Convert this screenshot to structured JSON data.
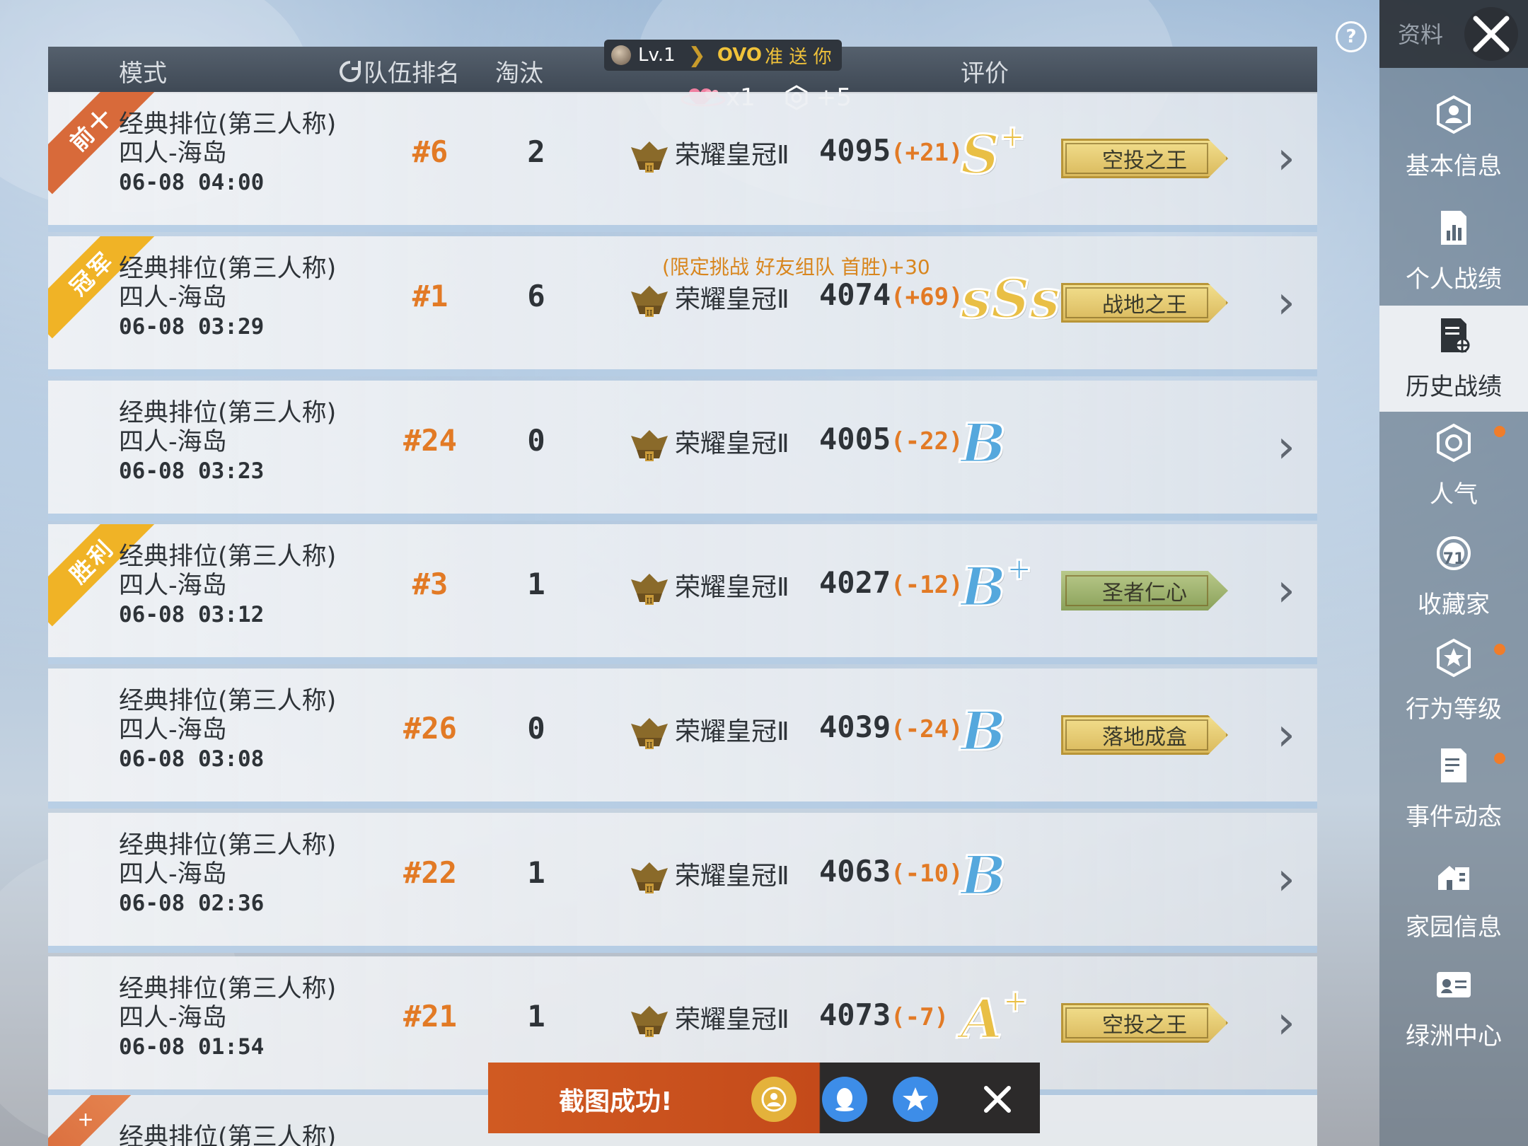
{
  "header": {
    "col_mode": "模式",
    "col_team_rank": "队伍排名",
    "col_eliminations": "淘汰",
    "col_rating": "评价",
    "level": "Lv.1",
    "player_name": "OVO",
    "player_name_suffix": "准 送 你",
    "likes_count": "x1",
    "popularity_gain": "+5"
  },
  "rows": [
    {
      "ribbon": "前十",
      "ribbon_color": "#d86a3a",
      "mode": "经典排位(第三人称)",
      "map": "四人-海岛",
      "date": "06-08 04:00",
      "rank": "#6",
      "elims": "2",
      "tier": "荣耀皇冠Ⅱ",
      "score": "4095",
      "delta": "(+21)",
      "delta_color": "#e27a25",
      "grade": "S",
      "grade_plus": "+",
      "grade_color": "gold",
      "promo": "",
      "title": "空投之王",
      "title_style": "gold"
    },
    {
      "ribbon": "冠军",
      "ribbon_color": "#f0b326",
      "mode": "经典排位(第三人称)",
      "map": "四人-海岛",
      "date": "06-08 03:29",
      "rank": "#1",
      "elims": "6",
      "tier": "荣耀皇冠Ⅱ",
      "score": "4074",
      "delta": "(+69)",
      "delta_color": "#e27a25",
      "grade": "sSs",
      "grade_plus": "",
      "grade_color": "gold",
      "promo": "(限定挑战 好友组队 首胜)+30",
      "title": "战地之王",
      "title_style": "gold"
    },
    {
      "ribbon": "",
      "ribbon_color": "",
      "mode": "经典排位(第三人称)",
      "map": "四人-海岛",
      "date": "06-08 03:23",
      "rank": "#24",
      "elims": "0",
      "tier": "荣耀皇冠Ⅱ",
      "score": "4005",
      "delta": "(-22)",
      "delta_color": "#e27a25",
      "grade": "B",
      "grade_plus": "",
      "grade_color": "blue",
      "promo": "",
      "title": "",
      "title_style": ""
    },
    {
      "ribbon": "胜利",
      "ribbon_color": "#f0b326",
      "mode": "经典排位(第三人称)",
      "map": "四人-海岛",
      "date": "06-08 03:12",
      "rank": "#3",
      "elims": "1",
      "tier": "荣耀皇冠Ⅱ",
      "score": "4027",
      "delta": "(-12)",
      "delta_color": "#e27a25",
      "grade": "B",
      "grade_plus": "+",
      "grade_color": "blue",
      "promo": "",
      "title": "圣者仁心",
      "title_style": "green"
    },
    {
      "ribbon": "",
      "ribbon_color": "",
      "mode": "经典排位(第三人称)",
      "map": "四人-海岛",
      "date": "06-08 03:08",
      "rank": "#26",
      "elims": "0",
      "tier": "荣耀皇冠Ⅱ",
      "score": "4039",
      "delta": "(-24)",
      "delta_color": "#e27a25",
      "grade": "B",
      "grade_plus": "",
      "grade_color": "blue",
      "promo": "",
      "title": "落地成盒",
      "title_style": "gold"
    },
    {
      "ribbon": "",
      "ribbon_color": "",
      "mode": "经典排位(第三人称)",
      "map": "四人-海岛",
      "date": "06-08 02:36",
      "rank": "#22",
      "elims": "1",
      "tier": "荣耀皇冠Ⅱ",
      "score": "4063",
      "delta": "(-10)",
      "delta_color": "#e27a25",
      "grade": "B",
      "grade_plus": "",
      "grade_color": "blue",
      "promo": "",
      "title": "",
      "title_style": ""
    },
    {
      "ribbon": "",
      "ribbon_color": "",
      "mode": "经典排位(第三人称)",
      "map": "四人-海岛",
      "date": "06-08 01:54",
      "rank": "#21",
      "elims": "1",
      "tier": "荣耀皇冠Ⅱ",
      "score": "4073",
      "delta": "(-7)",
      "delta_color": "#e27a25",
      "grade": "A",
      "grade_plus": "+",
      "grade_color": "gold",
      "promo": "",
      "title": "空投之王",
      "title_style": "gold"
    }
  ],
  "partial_row": {
    "mode": "经典排位(第三人称)"
  },
  "top_right": {
    "label": "资料"
  },
  "sidebar": {
    "items": [
      {
        "label": "基本信息",
        "icon": "user-badge-icon",
        "active": false
      },
      {
        "label": "个人战绩",
        "icon": "stats-chart-icon",
        "active": false
      },
      {
        "label": "历史战绩",
        "icon": "history-doc-icon",
        "active": true
      },
      {
        "label": "人气",
        "icon": "popularity-icon",
        "active": false
      },
      {
        "label": "收藏家",
        "icon": "collector-icon",
        "active": false
      },
      {
        "label": "行为等级",
        "icon": "behavior-level-icon",
        "active": false
      },
      {
        "label": "事件动态",
        "icon": "event-doc-icon",
        "active": false
      },
      {
        "label": "家园信息",
        "icon": "home-icon",
        "active": false
      },
      {
        "label": "绿洲中心",
        "icon": "oasis-id-icon",
        "active": false
      }
    ],
    "collector_badge": "71"
  },
  "toast": {
    "message": "截图成功!"
  },
  "colors": {
    "accent_orange": "#e27a25",
    "header_bg": "#47515d",
    "gold_grade": "#e9bf45",
    "blue_grade": "#55a8dd"
  }
}
